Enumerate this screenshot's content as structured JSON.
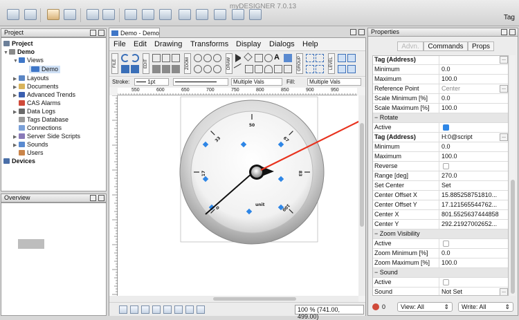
{
  "app": {
    "title": "myDESIGNER 7.0.13",
    "tag_label": "Tag"
  },
  "project": {
    "header": "Project",
    "items": [
      {
        "label": "Project",
        "bold": true
      },
      {
        "label": "Demo",
        "bold": true
      },
      {
        "label": "Views"
      },
      {
        "label": "Demo"
      },
      {
        "label": "Layouts"
      },
      {
        "label": "Documents"
      },
      {
        "label": "Advanced Trends"
      },
      {
        "label": "CAS Alarms"
      },
      {
        "label": "Data Logs"
      },
      {
        "label": "Tags Database"
      },
      {
        "label": "Connections"
      },
      {
        "label": "Server Side Scripts"
      },
      {
        "label": "Sounds"
      },
      {
        "label": "Users"
      },
      {
        "label": "Devices",
        "bold": true
      }
    ]
  },
  "overview": {
    "header": "Overview"
  },
  "editor": {
    "tab_label": "Demo - Demo",
    "menu": [
      "File",
      "Edit",
      "Drawing",
      "Transforms",
      "Display",
      "Dialogs",
      "Help"
    ],
    "ribbon_labels": [
      "FILE",
      "EDIT",
      "ZOOM",
      "DRAW",
      "GROUP",
      "LEVEL"
    ],
    "stroke_label": "Stroke:",
    "stroke_width": "1pt",
    "stroke_multi": "Multiple Vals",
    "fill_label": "Fill:",
    "fill_multi": "Multiple Vals",
    "ruler_ticks": [
      "550",
      "600",
      "650",
      "700",
      "750",
      "800",
      "850",
      "900",
      "950"
    ],
    "zoom_readout": "100 % (741.00, 499.00)"
  },
  "gauge": {
    "labels": [
      "0",
      "17",
      "33",
      "50",
      "67",
      "83",
      "100"
    ],
    "unit": "unit"
  },
  "properties": {
    "header": "Properties",
    "tabs": [
      "Advn.",
      "Commands",
      "Props"
    ],
    "rows": [
      {
        "name": "Tag (Address)",
        "value": "",
        "bold": true,
        "dots": true
      },
      {
        "name": "Minimum",
        "value": "0.0"
      },
      {
        "name": "Maximum",
        "value": "100.0"
      },
      {
        "name": "Reference Point",
        "value": "Center",
        "gray": true,
        "dots": true
      },
      {
        "name": "Scale Minimum [%]",
        "value": "0.0"
      },
      {
        "name": "Scale Maximum [%]",
        "value": "100.0"
      },
      {
        "name": "Rotate",
        "group": true
      },
      {
        "name": "Active",
        "check": "on"
      },
      {
        "name": "Tag (Address)",
        "value": "H:0@script",
        "bold": true,
        "dots": true
      },
      {
        "name": "Minimum",
        "value": "0.0"
      },
      {
        "name": "Maximum",
        "value": "100.0"
      },
      {
        "name": "Reverse",
        "check": "off"
      },
      {
        "name": "Range [deg]",
        "value": "270.0"
      },
      {
        "name": "Set Center",
        "value": "Set"
      },
      {
        "name": "Center Offset X",
        "value": "15.885258751810..."
      },
      {
        "name": "Center Offset Y",
        "value": "17.121565544762..."
      },
      {
        "name": "Center X",
        "value": "801.5525637444858"
      },
      {
        "name": "Center Y",
        "value": "292.21927002652..."
      },
      {
        "name": "Zoom Visibility",
        "group": true
      },
      {
        "name": "Active",
        "check": "off"
      },
      {
        "name": "Zoom Minimum [%]",
        "value": "0.0"
      },
      {
        "name": "Zoom Maximum [%]",
        "value": "100.0"
      },
      {
        "name": "Sound",
        "group": true
      },
      {
        "name": "Active",
        "check": "off"
      },
      {
        "name": "Sound",
        "value": "Not Set",
        "dots": true
      }
    ],
    "footer": {
      "count": "0",
      "view": "View: All",
      "write": "Write: All"
    }
  },
  "colors": {
    "accent": "#2e86e6",
    "arrow": "#e8321e",
    "ribbon_blue": "#3a6fb8"
  }
}
